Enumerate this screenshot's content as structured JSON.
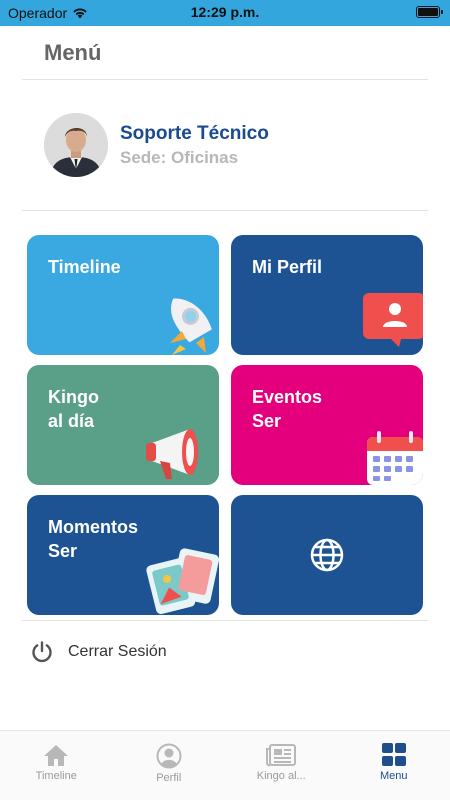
{
  "status_bar": {
    "carrier": "Operador",
    "time": "12:29 p.m."
  },
  "header": {
    "title": "Menú"
  },
  "profile": {
    "name": "Soporte Técnico",
    "sede": "Sede: Oficinas"
  },
  "tiles": [
    {
      "label": "Timeline",
      "color": "#3aa9e1",
      "icon": "rocket-icon"
    },
    {
      "label": "Mi Perfil",
      "color": "#1e5393",
      "icon": "profile-card-icon"
    },
    {
      "label": "Kingo\nal día",
      "color": "#5a9f87",
      "icon": "megaphone-icon"
    },
    {
      "label": "Eventos\nSer",
      "color": "#e4007c",
      "icon": "calendar-icon"
    },
    {
      "label": "Momentos\nSer",
      "color": "#1e5393",
      "icon": "photos-icon"
    },
    {
      "label": "",
      "color": "#1e5393",
      "icon": "globe-icon"
    }
  ],
  "logout": {
    "label": "Cerrar Sesión"
  },
  "tab_bar": {
    "items": [
      {
        "label": "Timeline",
        "icon": "home-icon"
      },
      {
        "label": "Perfil",
        "icon": "person-icon"
      },
      {
        "label": "Kingo al...",
        "icon": "newspaper-icon"
      },
      {
        "label": "Menu",
        "icon": "grid-icon",
        "active": true
      }
    ]
  },
  "colors": {
    "status_bar": "#33a7dd",
    "brand_blue": "#1e5393",
    "accent_name": "#1a4a8f"
  }
}
